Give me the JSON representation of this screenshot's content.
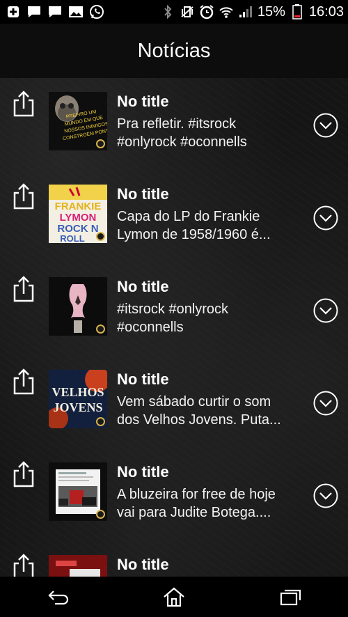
{
  "status_bar": {
    "battery_percent": "15%",
    "time": "16:03",
    "left_icons": [
      "plus-icon",
      "chat-icon",
      "chat-icon",
      "image-icon",
      "whatsapp-icon"
    ],
    "right_icons": [
      "bluetooth-icon",
      "vibrate-icon",
      "alarm-icon",
      "wifi-icon",
      "signal-icon",
      "battery-icon"
    ]
  },
  "header": {
    "title": "Notícias"
  },
  "items": [
    {
      "title": "No title",
      "line1": "Pra refletir. #itsrock",
      "line2": "#onlyrock #oconnells"
    },
    {
      "title": "No title",
      "line1": "Capa do LP do Frankie",
      "line2": "Lymon de 1958/1960 é..."
    },
    {
      "title": "No title",
      "line1": "#itsrock #onlyrock",
      "line2": "#oconnells"
    },
    {
      "title": "No title",
      "line1": "Vem sábado curtir o som",
      "line2": "dos Velhos Jovens. Puta..."
    },
    {
      "title": "No title",
      "line1": "A bluzeira for free de hoje",
      "line2": "vai para Judite Botega...."
    },
    {
      "title": "No title",
      "line1": "",
      "line2": ""
    }
  ],
  "thumbnails": [
    {
      "text": "PREFIRO UM MUNDO EM QUE NOSSOS INIMIGOS CONSTROEM PONTES"
    },
    {
      "text": "FRANKIE LYMON ROCK N ROLL"
    },
    {
      "text": ""
    },
    {
      "text": "VELHOS JOVENS"
    },
    {
      "text": ""
    },
    {
      "text": ""
    }
  ],
  "navigation": {
    "buttons": [
      "back-icon",
      "home-icon",
      "recent-apps-icon"
    ]
  },
  "colors": {
    "accent_badge": "#d6b24a",
    "background": "#000000",
    "text": "#ffffff"
  }
}
